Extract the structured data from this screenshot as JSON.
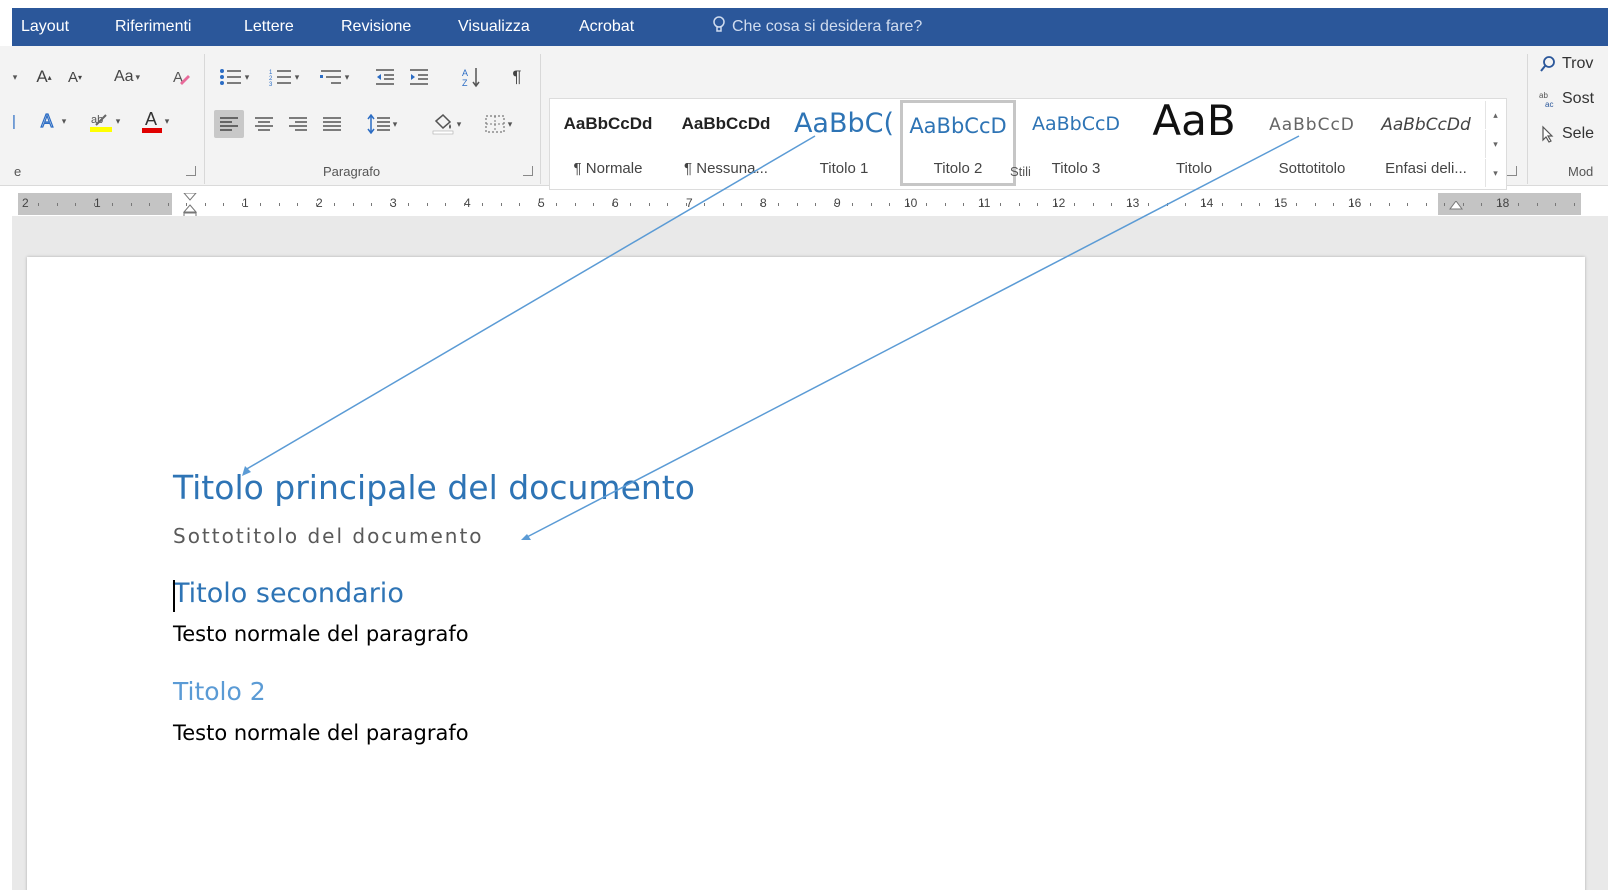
{
  "menu_tabs": [
    "Layout",
    "Riferimenti",
    "Lettere",
    "Revisione",
    "Visualizza",
    "Acrobat"
  ],
  "tell_me": "Che cosa si desidera fare?",
  "ribbon": {
    "font_group_label_fragment": "e",
    "paragraph_group_label": "Paragrafo",
    "styles_group_label": "Stili",
    "editing_group_label": "Mod",
    "font_buttons": {
      "grow_font": "A",
      "shrink_font": "A",
      "change_case": "Aa",
      "highlight": "ab",
      "font_color": "A"
    },
    "editing_items": [
      {
        "icon": "search-icon",
        "label": "Trov"
      },
      {
        "icon": "replace-icon",
        "label": "Sost"
      },
      {
        "icon": "select-cursor-icon",
        "label": "Sele"
      }
    ]
  },
  "styles": [
    {
      "preview": "AaBbCcDd",
      "name": "¶ Normale"
    },
    {
      "preview": "AaBbCcDd",
      "name": "¶ Nessuna..."
    },
    {
      "preview": "AaBbC(",
      "name": "Titolo 1"
    },
    {
      "preview": "AaBbCcD",
      "name": "Titolo 2",
      "selected": true
    },
    {
      "preview": "AaBbCcD",
      "name": "Titolo 3"
    },
    {
      "preview": "AaB",
      "name": "Titolo"
    },
    {
      "preview": "AaBbCcD",
      "name": "Sottotitolo"
    },
    {
      "preview": "AaBbCcDd",
      "name": "Enfasi deli..."
    }
  ],
  "ruler": {
    "left_numbers": [
      "2",
      "1"
    ],
    "numbers": [
      "1",
      "2",
      "3",
      "4",
      "5",
      "6",
      "7",
      "8",
      "9",
      "10",
      "11",
      "12",
      "13",
      "14",
      "15",
      "16",
      "18"
    ]
  },
  "document": {
    "title": "Titolo principale del documento",
    "subtitle": "Sottotitolo del documento",
    "heading1": "Titolo secondario",
    "paragraph1": "Testo normale del paragrafo",
    "heading2": "Titolo 2",
    "paragraph2": "Testo normale del paragrafo"
  },
  "colors": {
    "tab_bar": "#2b579a",
    "heading_blue": "#2e74b5",
    "heading2_blue": "#5b9bd5",
    "annotation_line": "#5b9bd5"
  }
}
